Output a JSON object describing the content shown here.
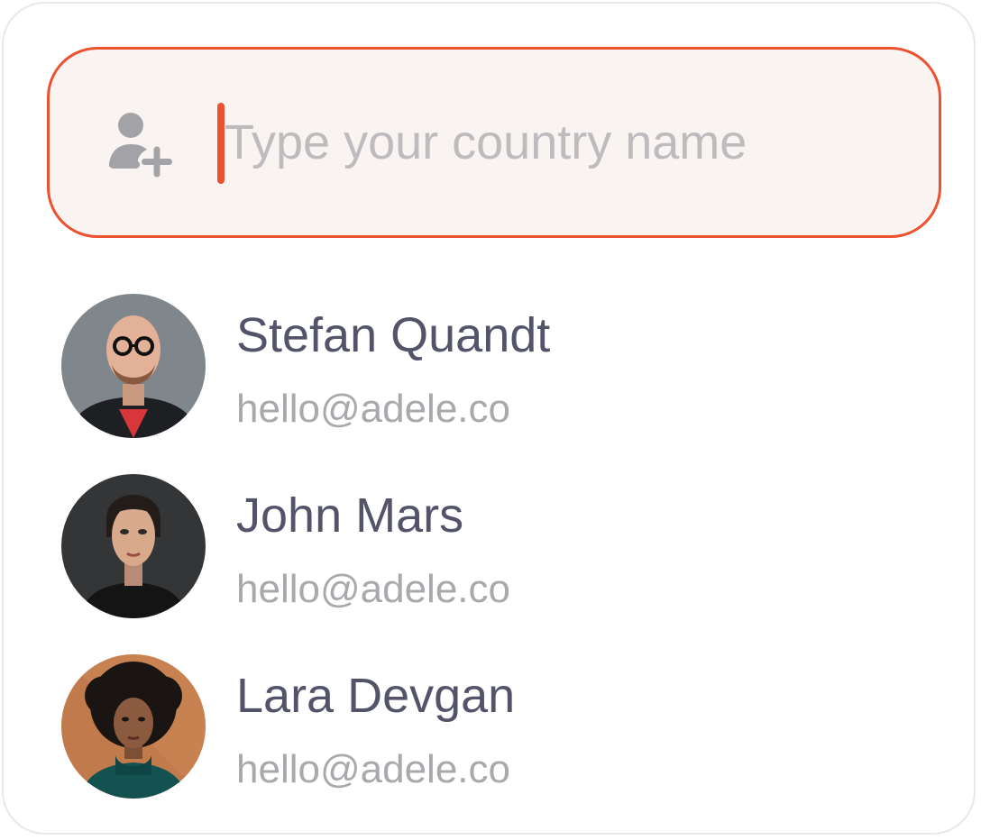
{
  "search": {
    "placeholder": "Type your country name",
    "value": "",
    "icon": "user-add-icon"
  },
  "colors": {
    "accent": "#ec5230",
    "field_bg": "#f9f4f2",
    "name_text": "#53536a",
    "email_text": "#a9a8ad",
    "placeholder_text": "#bdbbbe"
  },
  "contacts": [
    {
      "name": "Stefan Quandt",
      "email": "hello@adele.co",
      "avatar": "avatar-photo"
    },
    {
      "name": "John Mars",
      "email": "hello@adele.co",
      "avatar": "avatar-photo"
    },
    {
      "name": "Lara Devgan",
      "email": "hello@adele.co",
      "avatar": "avatar-photo"
    }
  ]
}
